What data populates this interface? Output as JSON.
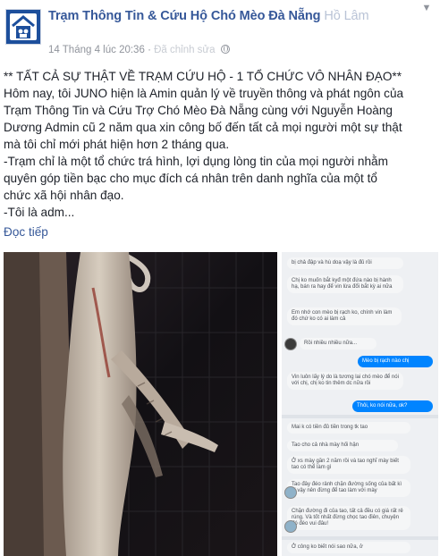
{
  "header": {
    "page_name": "Trạm Thông Tin & Cứu Hộ Chó Mèo Đà Nẵng",
    "page_name_blurred": "Hồ Lâm",
    "timestamp": "14 Tháng 4 lúc 20:36",
    "blurred_meta": "Đã chỉnh sửa"
  },
  "post": {
    "lines": [
      "** TẤT CẢ SỰ THẬT VỀ TRẠM CỨU HỘ - 1 TỔ CHỨC VÔ NHÂN ĐẠO**",
      "Hôm nay, tôi JUNO hiện là Amin quản lý về truyền thông và phát ngôn của",
      "Trạm Thông Tin và Cứu Trợ Chó Mèo Đà Nẵng cùng với Nguyễn Hoàng",
      "Dương Admin cũ 2 năm qua xin công bố đến tất cả mọi người một sự thật",
      "mà tôi chỉ mới phát hiện hơn 2 tháng qua.",
      "-Trạm chỉ là một tổ chức trá hình, lợi dụng lòng tin của mọi người nhằm",
      "quyên góp tiền bạc cho mục đích cá nhân trên danh nghĩa của một tổ",
      "chức xã hội nhân đạo.",
      "-Tôi là adm..."
    ],
    "see_more": "Đọc tiếp"
  },
  "chat": {
    "messages": [
      {
        "dir": "in",
        "text": "bị chả đập và hù doạ vậy là đủ rồi"
      },
      {
        "dir": "in",
        "text": "Chị ko muốn bắt kyđ một đứa nào bị hành hạ, bán ra hay để vin lừa đổi bắt kỳ ai nữa"
      },
      {
        "dir": "in",
        "text": "Em nhớ con mèo bị rạch ko, chính vin làm đó chứ ko có ai làm cả"
      },
      {
        "dir": "in",
        "text": "Rồi nhiều nhiều nữa..."
      },
      {
        "dir": "out",
        "text": "Mèo bị rạch nào chị"
      },
      {
        "dir": "in",
        "text": "Vin luôn lấy lý do là tương lai chó mèo để nói với chị, chị ko tin thêm dc nữa rồi"
      },
      {
        "dir": "out",
        "text": "Thôi, ko nói nữa, ok?"
      },
      {
        "dir": "in",
        "text": "Mai k có tiền đủ tiền trong tk tao"
      },
      {
        "dir": "in",
        "text": "Tao cho cả nhà mày hối hận"
      },
      {
        "dir": "in",
        "text": "Ở xs mày gần 2 năm rồi và tao nghĩ mày biết tao có thể làm gì"
      },
      {
        "dir": "in",
        "text": "Tao đây đéo rảnh chặn đường sống của bất kì ai vậy nên đừng để tao làm với mày"
      },
      {
        "dir": "in",
        "text": "Chặn đường đi của tao, tất cả đều có giá rất rẻ rúng. Và tốt nhất đừng chọc tao điên, chuyện đó đéo vui đâu!"
      },
      {
        "dir": "in",
        "text": "Ở công ko biết nói sao nữa, ở"
      }
    ]
  }
}
